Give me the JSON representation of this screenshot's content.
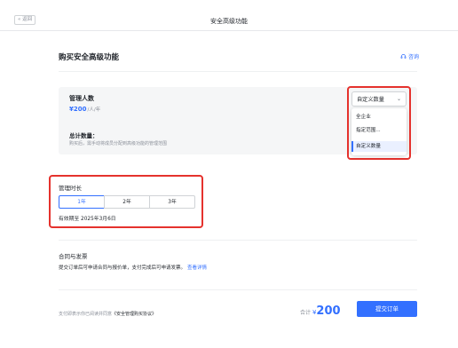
{
  "header": {
    "back_label": "« 返回",
    "title": "安全高级功能"
  },
  "main": {
    "title": "购买安全高级功能",
    "consult_label": "咨询",
    "admin_count_label": "管理人数",
    "price": "¥200",
    "price_unit": "/人/年",
    "total_count_label": "总计数量：",
    "total_count_desc": "购买后，需手动将成员分配到高级功能的管理范围"
  },
  "dropdown": {
    "selected": "自定义数量",
    "options": [
      "全企业",
      "指定范围...",
      "自定义数量"
    ],
    "active_index": 2
  },
  "duration": {
    "title": "管理时长",
    "options": [
      "1年",
      "2年",
      "3年"
    ],
    "selected_index": 0,
    "valid_until": "有效期至 2025年3月6日"
  },
  "contract": {
    "title": "合同与发票",
    "desc": "提交订单后可申请合同与报价单，支付完成后可申请发票。",
    "link": "查看详情"
  },
  "footer": {
    "agreement_prefix": "支付即表示你已阅读并同意",
    "agreement_link": "《安全管理购买协议》",
    "total_label": "合计",
    "currency": "¥",
    "amount": "200",
    "submit_label": "提交订单"
  },
  "colors": {
    "accent": "#3370ff",
    "highlight": "#e5322d"
  }
}
